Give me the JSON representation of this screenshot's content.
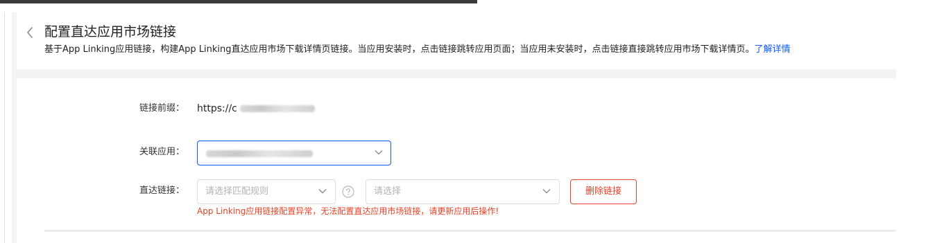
{
  "header": {
    "title": "配置直达应用市场链接",
    "description": "基于App Linking应用链接，构建App Linking直达应用市场下载详情页链接。当应用安装时，点击链接跳转应用页面；当应用未安装时，点击链接直接跳转应用市场下载详情页。",
    "learn_more": "了解详情"
  },
  "form": {
    "prefix": {
      "label": "链接前缀：",
      "value": "https://c"
    },
    "app": {
      "label": "关联应用："
    },
    "direct_link": {
      "label": "直达链接：",
      "rule_placeholder": "请选择匹配规则",
      "target_placeholder": "请选择",
      "delete_label": "删除链接",
      "error": "App Linking应用链接配置异常，无法配置直达应用市场链接，请更新应用后操作!"
    }
  },
  "colors": {
    "accent": "#0a59f7",
    "danger": "#e84026"
  },
  "icons": {
    "back": "chevron-left-icon",
    "dropdown": "chevron-down-icon",
    "help": "question-circle-icon"
  }
}
